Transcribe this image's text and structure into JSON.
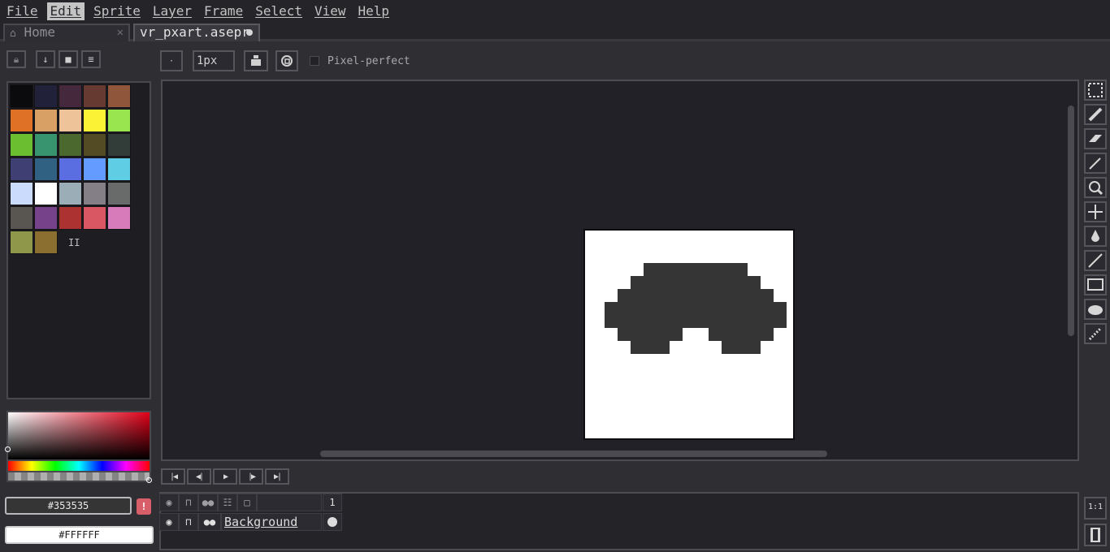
{
  "menu": [
    "File",
    "Edit",
    "Sprite",
    "Layer",
    "Frame",
    "Select",
    "View",
    "Help"
  ],
  "tabs": {
    "home": "Home",
    "document": "vr_pxart.asepr"
  },
  "toolbar": {
    "brush_size": "1px",
    "pixel_perfect_label": "Pixel-perfect"
  },
  "palette": {
    "colors": [
      "#0b0b0e",
      "#22213a",
      "#45283c",
      "#663931",
      "#8f563b",
      "#df7126",
      "#d9a066",
      "#eec39a",
      "#fbf236",
      "#99e550",
      "#6abe30",
      "#37946e",
      "#4b692f",
      "#524b24",
      "#323c39",
      "#3f3f74",
      "#306082",
      "#5b6ee1",
      "#639bff",
      "#5fcde4",
      "#cbdbfc",
      "#ffffff",
      "#9badb7",
      "#847e87",
      "#696a6a",
      "#595652",
      "#76428a",
      "#ac3232",
      "#d95763",
      "#d77bba",
      "#8f974a",
      "#8a6f30"
    ],
    "more_indicator": "II"
  },
  "colors": {
    "foreground": "#353535",
    "background": "#FFFFFF",
    "warning_glyph": "!"
  },
  "sprite": {
    "ink": "#353535",
    "paper": "#ffffff"
  },
  "timeline": {
    "layer_name": "Background",
    "frame_number": "1",
    "zoom_label": "1:1"
  }
}
